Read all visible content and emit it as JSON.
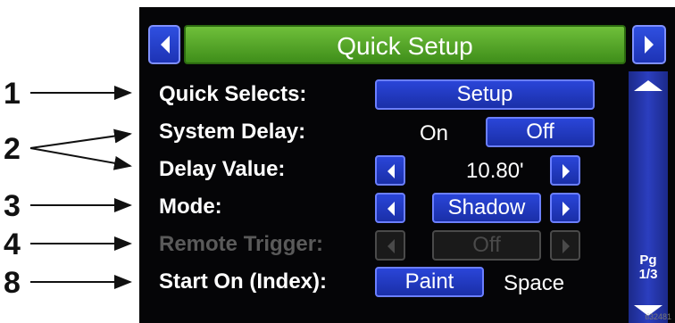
{
  "title": "Quick Setup",
  "callouts": [
    "1",
    "2",
    "3",
    "4",
    "8"
  ],
  "rows": {
    "quick_selects": {
      "label": "Quick Selects:",
      "button": "Setup"
    },
    "system_delay": {
      "label": "System Delay:",
      "on": "On",
      "off": "Off"
    },
    "delay_value": {
      "label": "Delay Value:",
      "value": "10.80'"
    },
    "mode": {
      "label": "Mode:",
      "value": "Shadow"
    },
    "remote_trigger": {
      "label": "Remote Trigger:",
      "value": "Off"
    },
    "start_on": {
      "label": "Start On (Index):",
      "paint": "Paint",
      "space": "Space"
    }
  },
  "pager": {
    "label": "Pg",
    "page": "1/3"
  },
  "reference": "ti32481",
  "colors": {
    "title_green": "#4fa326",
    "button_blue": "#1f35c4",
    "screen_bg": "#050507"
  }
}
